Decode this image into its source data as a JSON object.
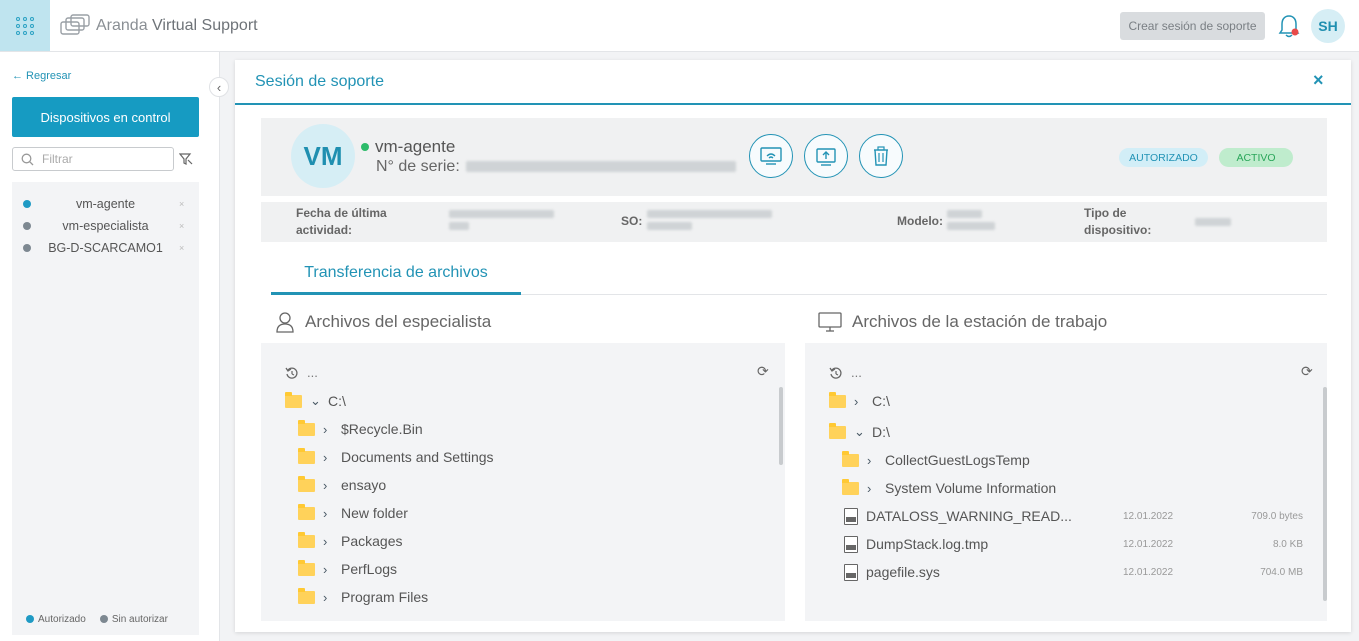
{
  "header": {
    "app_name_light": "Aranda",
    "app_name_bold": "Virtual Support",
    "create_session_label": "Crear sesión de soporte",
    "user_initials": "SH"
  },
  "sidebar": {
    "back_label": "← Regresar",
    "devices_button_label": "Dispositivos en control",
    "filter_placeholder": "Filtrar",
    "devices": [
      {
        "name": "vm-agente",
        "status_color": "#1f9ac4"
      },
      {
        "name": "vm-especialista",
        "status_color": "#7d8891"
      },
      {
        "name": "BG-D-SCARCAMO1",
        "status_color": "#7d8891"
      }
    ],
    "legend": {
      "authorized_label": "Autorizado",
      "authorized_color": "#1f9ac4",
      "unauthorized_label": "Sin autorizar",
      "unauthorized_color": "#7d8891"
    }
  },
  "modal": {
    "title": "Sesión de soporte",
    "close_label": "×",
    "device": {
      "initials": "VM",
      "name": "vm-agente",
      "serial_label": "N° de serie:",
      "badge_authorized": "AUTORIZADO",
      "badge_active": "ACTIVO"
    },
    "info": {
      "last_activity_label": "Fecha de última actividad:",
      "os_label": "SO:",
      "model_label": "Modelo:",
      "device_type_label": "Tipo de dispositivo:"
    },
    "tab_label": "Transferencia de archivos",
    "specialist_pane": {
      "title": "Archivos del especialista",
      "up_label": "...",
      "root": "C:\\",
      "folders": [
        "$Recycle.Bin",
        "Documents and Settings",
        "ensayo",
        "New folder",
        "Packages",
        "PerfLogs",
        "Program Files"
      ]
    },
    "workstation_pane": {
      "title": "Archivos de la estación de trabajo",
      "up_label": "...",
      "drive_c": "C:\\",
      "drive_d": "D:\\",
      "folders": [
        "CollectGuestLogsTemp",
        "System Volume Information"
      ],
      "files": [
        {
          "name": "DATALOSS_WARNING_READ...",
          "date": "12.01.2022",
          "size": "709.0 bytes"
        },
        {
          "name": "DumpStack.log.tmp",
          "date": "12.01.2022",
          "size": "8.0 KB"
        },
        {
          "name": "pagefile.sys",
          "date": "12.01.2022",
          "size": "704.0 MB"
        }
      ]
    }
  }
}
